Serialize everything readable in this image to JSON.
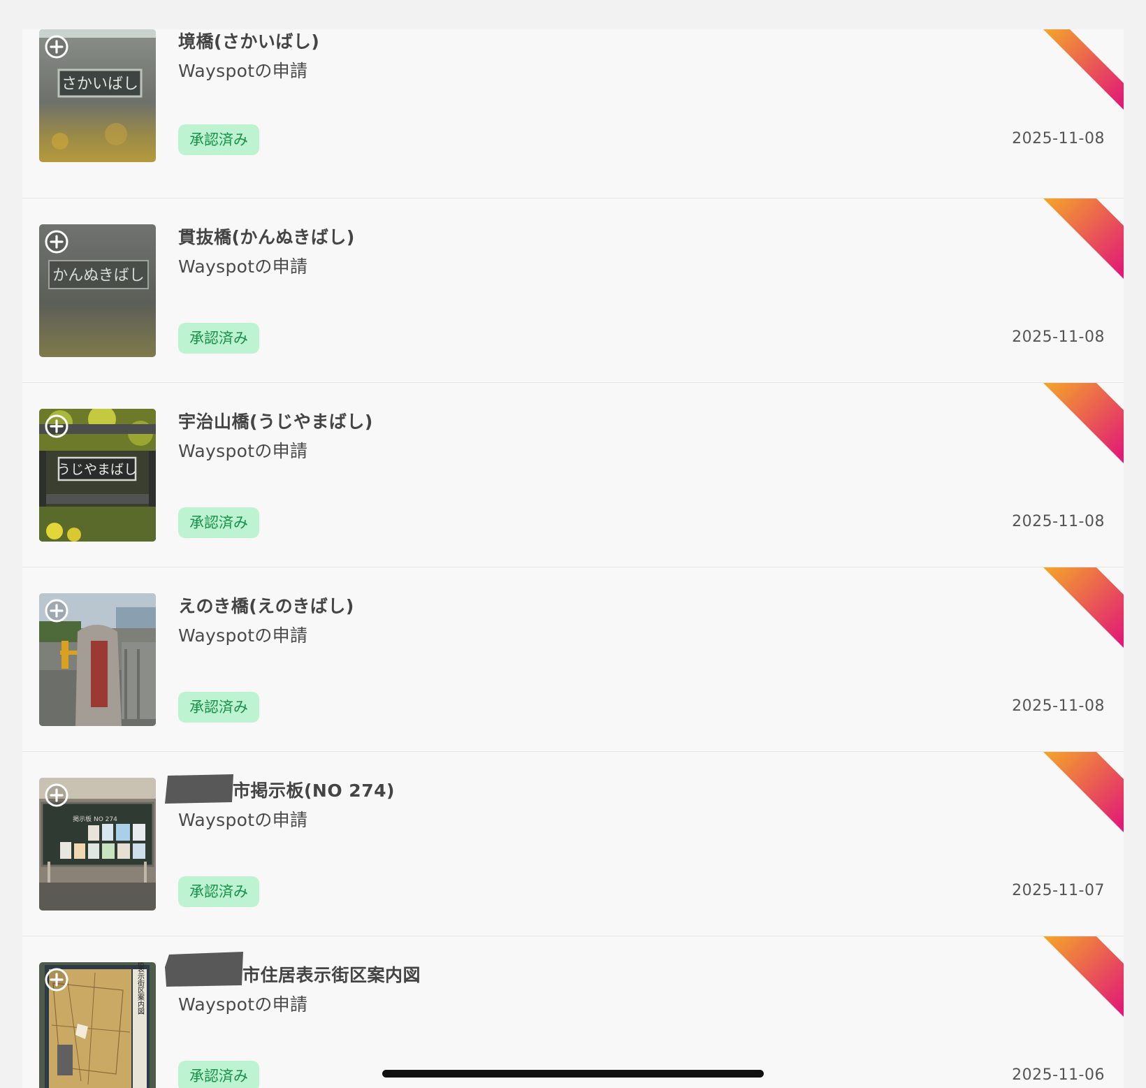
{
  "submissions": [
    {
      "title": "境橋(さかいばし)",
      "type": "Wayspotの申請",
      "status": "承認済み",
      "date": "2025-11-08",
      "thumbnail_sign_text": "さかいばし"
    },
    {
      "title": "貫抜橋(かんぬきばし)",
      "type": "Wayspotの申請",
      "status": "承認済み",
      "date": "2025-11-08",
      "thumbnail_sign_text": "かんぬきばし"
    },
    {
      "title": "宇治山橋(うじやまばし)",
      "type": "Wayspotの申請",
      "status": "承認済み",
      "date": "2025-11-08",
      "thumbnail_sign_text": "うじやまばし"
    },
    {
      "title": "えのき橋(えのきばし)",
      "type": "Wayspotの申請",
      "status": "承認済み",
      "date": "2025-11-08"
    },
    {
      "title": "市掲示板(NO 274)",
      "type": "Wayspotの申請",
      "status": "承認済み",
      "date": "2025-11-07",
      "thumbnail_sign_text": "掲示板 NO 274"
    },
    {
      "title": "市住居表示街区案内図",
      "type": "Wayspotの申請",
      "status": "承認済み",
      "date": "2025-11-06",
      "thumbnail_sign_text": "住居表示街区案内図"
    }
  ],
  "icons": {
    "add": "plus-circle-icon",
    "corner": "status-corner-ribbon"
  },
  "colors": {
    "badge_bg": "#bdf3d0",
    "badge_text": "#17904a",
    "ribbon_start": "#f4a72a",
    "ribbon_end": "#e0137a"
  }
}
